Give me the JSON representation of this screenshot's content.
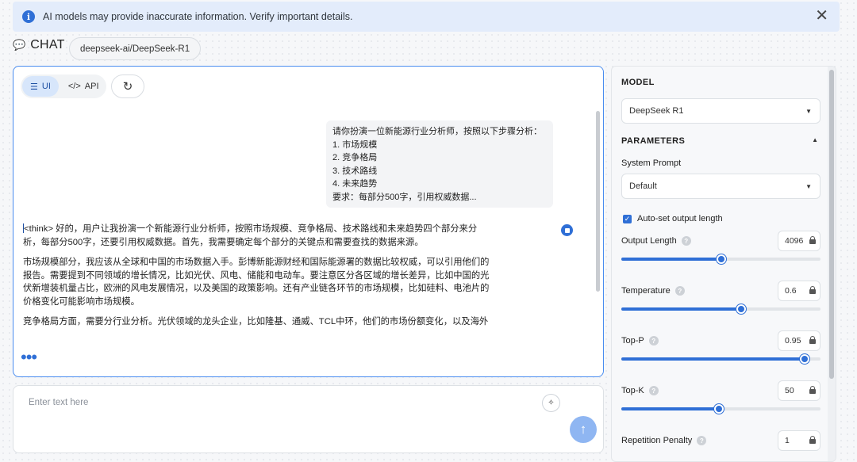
{
  "banner": {
    "message": "AI models may provide inaccurate information. Verify important details.",
    "info_glyph": "i",
    "close_glyph": "✕"
  },
  "header": {
    "chat_icon": "💬",
    "title": "CHAT",
    "model_pill": "deepseek-ai/DeepSeek-R1"
  },
  "chat": {
    "toggle": [
      {
        "label": "UI",
        "icon": "☰",
        "active": true
      },
      {
        "label": "API",
        "icon": "</>",
        "active": false
      }
    ],
    "refresh_glyph": "↻",
    "user_message_lines": [
      "请你扮演一位新能源行业分析师，按照以下步骤分析：",
      "1. 市场规模",
      "2. 竞争格局",
      "3. 技术路线",
      "4. 未来趋势",
      "要求：每部分500字，引用权威数据..."
    ],
    "assistant_paragraphs": [
      "<think> 好的，用户让我扮演一个新能源行业分析师，按照市场规模、竞争格局、技术路线和未来趋势四个部分来分析，每部分500字，还要引用权威数据。首先，我需要确定每个部分的关键点和需要查找的数据来源。",
      "市场规模部分，我应该从全球和中国的市场数据入手。彭博新能源财经和国际能源署的数据比较权威，可以引用他们的报告。需要提到不同领域的增长情况，比如光伏、风电、储能和电动车。要注意区分各区域的增长差异，比如中国的光伏新增装机量占比，欧洲的风电发展情况，以及美国的政策影响。还有产业链各环节的市场规模，比如硅料、电池片的价格变化可能影响市场规模。",
      "竞争格局方面，需要分行业分析。光伏领域的龙头企业，比如隆基、通威、TCL中环，他们的市场份额变化，以及海外"
    ],
    "loading_glyph": "•••"
  },
  "input": {
    "placeholder": "Enter text here",
    "magic_glyph": "✧",
    "send_glyph": "↑"
  },
  "settings": {
    "model_section": "MODEL",
    "model_value": "DeepSeek R1",
    "parameters_section": "PARAMETERS",
    "system_prompt_label": "System Prompt",
    "system_prompt_value": "Default",
    "autoset_label": "Auto-set output length",
    "autoset_checked": true,
    "params": [
      {
        "label": "Output Length",
        "value": "4096",
        "fraction": 0.5
      },
      {
        "label": "Temperature",
        "value": "0.6",
        "fraction": 0.6
      },
      {
        "label": "Top-P",
        "value": "0.95",
        "fraction": 0.92
      },
      {
        "label": "Top-K",
        "value": "50",
        "fraction": 0.49
      },
      {
        "label": "Repetition Penalty",
        "value": "1",
        "fraction": null
      }
    ]
  },
  "colors": {
    "accent": "#2f6fd6",
    "banner_bg": "#e3ecfb",
    "send_button": "#8fb6f2"
  }
}
